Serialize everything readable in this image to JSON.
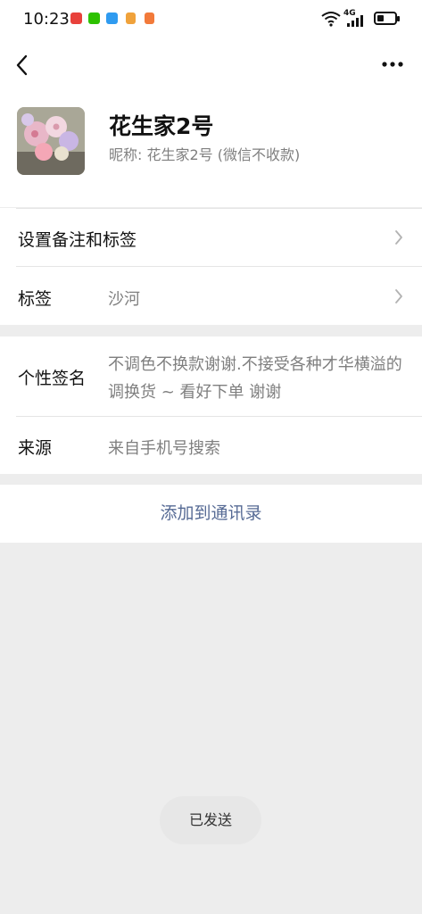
{
  "status_bar": {
    "time": "10:23",
    "network_label": "4G",
    "notification_icons": [
      "app-notification-red-icon",
      "wechat-icon",
      "message-icon",
      "gift-icon",
      "shopping-icon"
    ]
  },
  "nav": {
    "back_icon": "chevron-left-icon",
    "more_icon": "more-dots-icon"
  },
  "profile": {
    "name": "花生家2号",
    "nickname_line": "昵称:  花生家2号  (微信不收款)"
  },
  "rows": {
    "remark_label": "设置备注和标签",
    "tag_label": "标签",
    "tag_value": "沙河",
    "signature_label": "个性签名",
    "signature_value": "不调色不换款谢谢.不接受各种才华横溢的调换货 ~ 看好下单 谢谢",
    "source_label": "来源",
    "source_value": "来自手机号搜索"
  },
  "actions": {
    "add_contact": "添加到通讯录"
  },
  "toast": {
    "text": "已发送"
  },
  "colors": {
    "link": "#576b95",
    "secondary_text": "#7f7f7f",
    "background": "#ededed"
  }
}
